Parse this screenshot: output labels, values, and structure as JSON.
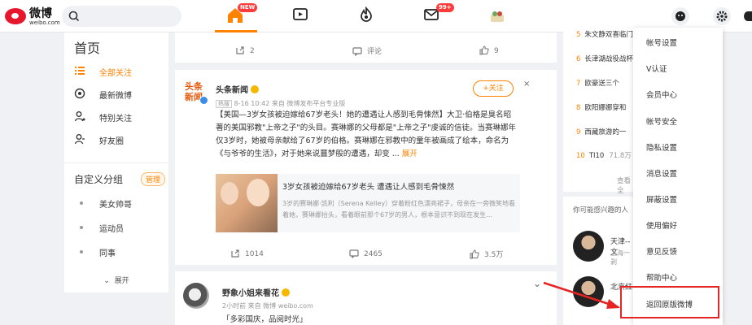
{
  "header": {
    "logo_text": "微博",
    "logo_domain": "weibo.com",
    "home_badge": "NEW",
    "message_badge": "99+",
    "home_label": "首页"
  },
  "sidebar": {
    "items": [
      {
        "label": "全部关注"
      },
      {
        "label": "最新微博"
      },
      {
        "label": "特别关注"
      },
      {
        "label": "好友圈"
      }
    ],
    "custom_group_title": "自定义分组",
    "manage_label": "管理",
    "groups": [
      {
        "label": "美女帅哥"
      },
      {
        "label": "运动员"
      },
      {
        "label": "同事"
      }
    ],
    "expand_label": "展开"
  },
  "feed": {
    "top_actions": {
      "repost": "2",
      "comment": "评论",
      "like": "9"
    },
    "post1": {
      "author": "头条新闻",
      "avatar_text": "头条新闻",
      "hot_tag": "热搜",
      "meta": "8-16 10:42 来自 微博发布平台专业版",
      "follow_label": "+关注",
      "close": "×",
      "text": "【美国—3岁女孩被迫嫁给67岁老头！她的遭遇让人感到毛骨悚然】大卫·伯格是臭名昭著的美国邪教\"上帝之子\"的头目。赛琳娜的父母都是\"上帝之子\"虔诚的信徒。当赛琳娜年仅3岁时，她被母亲献给了67岁的伯格。赛琳娜在邪教中的童年被画成了绘本，命名为《与爷爷的生活》，对于她来说噩梦般的遭遇，却变 ...",
      "expand": "展开",
      "link_title": "3岁女孩被迫嫁给67岁老头 遭遇让人感到毛骨悚然",
      "link_desc": "3岁的赛琳娜·凯利（Serena Kelley）穿着粉红色漂亮裙子，母亲在一旁微笑地看着她，赛琳娜抬头，看着眼前那个67岁的男人，根本意识不到现在发生...",
      "repost": "1014",
      "comment": "2465",
      "like": "3.5万"
    },
    "post2": {
      "author": "野象小姐来看花",
      "meta": "2小时前 来自 微博 weibo.com",
      "text": "「多彩国庆，品阅时光」"
    }
  },
  "right_column": {
    "hot_list": [
      {
        "num": "5",
        "title": "朱文静双喜临门",
        "value": ""
      },
      {
        "num": "6",
        "title": "长津湖战役战杯",
        "value": ""
      },
      {
        "num": "7",
        "title": "欧豪送三个",
        "value": ""
      },
      {
        "num": "8",
        "title": "欧阳娜娜穿和",
        "value": ""
      },
      {
        "num": "9",
        "title": "西藏旅游的一",
        "value": ""
      },
      {
        "num": "10",
        "title": "TI10",
        "value": "71.8万"
      }
    ],
    "more_label": "查看全",
    "rec_title": "你可能感兴趣的人",
    "recs": [
      {
        "name": "天津--文",
        "sub": "上海一剥"
      },
      {
        "name": "北京红",
        "sub": ""
      }
    ]
  },
  "dropdown": {
    "items": [
      {
        "label": "帐号设置"
      },
      {
        "label": "V认证"
      },
      {
        "label": "会员中心"
      },
      {
        "label": "帐号安全"
      },
      {
        "label": "隐私设置"
      },
      {
        "label": "消息设置"
      },
      {
        "label": "屏蔽设置"
      },
      {
        "label": "使用偏好"
      },
      {
        "label": "意见反馈"
      },
      {
        "label": "帮助中心"
      },
      {
        "label": "返回原版微博"
      }
    ],
    "highlighted": "返回原版微博"
  },
  "colors": {
    "accent": "#ff8200",
    "brand_red": "#e6162d",
    "annotation_red": "#e52424"
  }
}
